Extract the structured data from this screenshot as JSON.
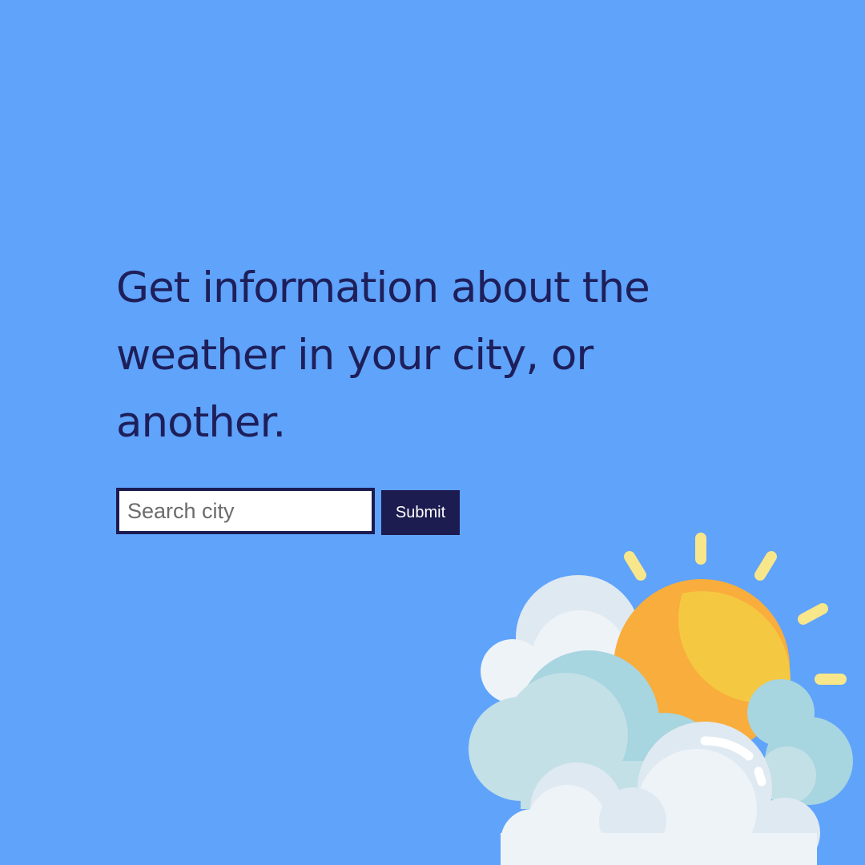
{
  "hero": {
    "headline": "Get information about the weather in your city, or another."
  },
  "search": {
    "placeholder": "Search city",
    "value": "",
    "submit_label": "Submit"
  },
  "illustration": {
    "icon": "partly-cloudy-sun-icon"
  },
  "colors": {
    "background": "#5fa3fb",
    "headline": "#1e1f5a",
    "button": "#1d1c50",
    "sun": "#f5c842",
    "sun_shade": "#f8ad3c",
    "sun_ray": "#f8e68a",
    "cloud_light": "#eef3f8",
    "cloud_blue": "#a7d5e0"
  }
}
